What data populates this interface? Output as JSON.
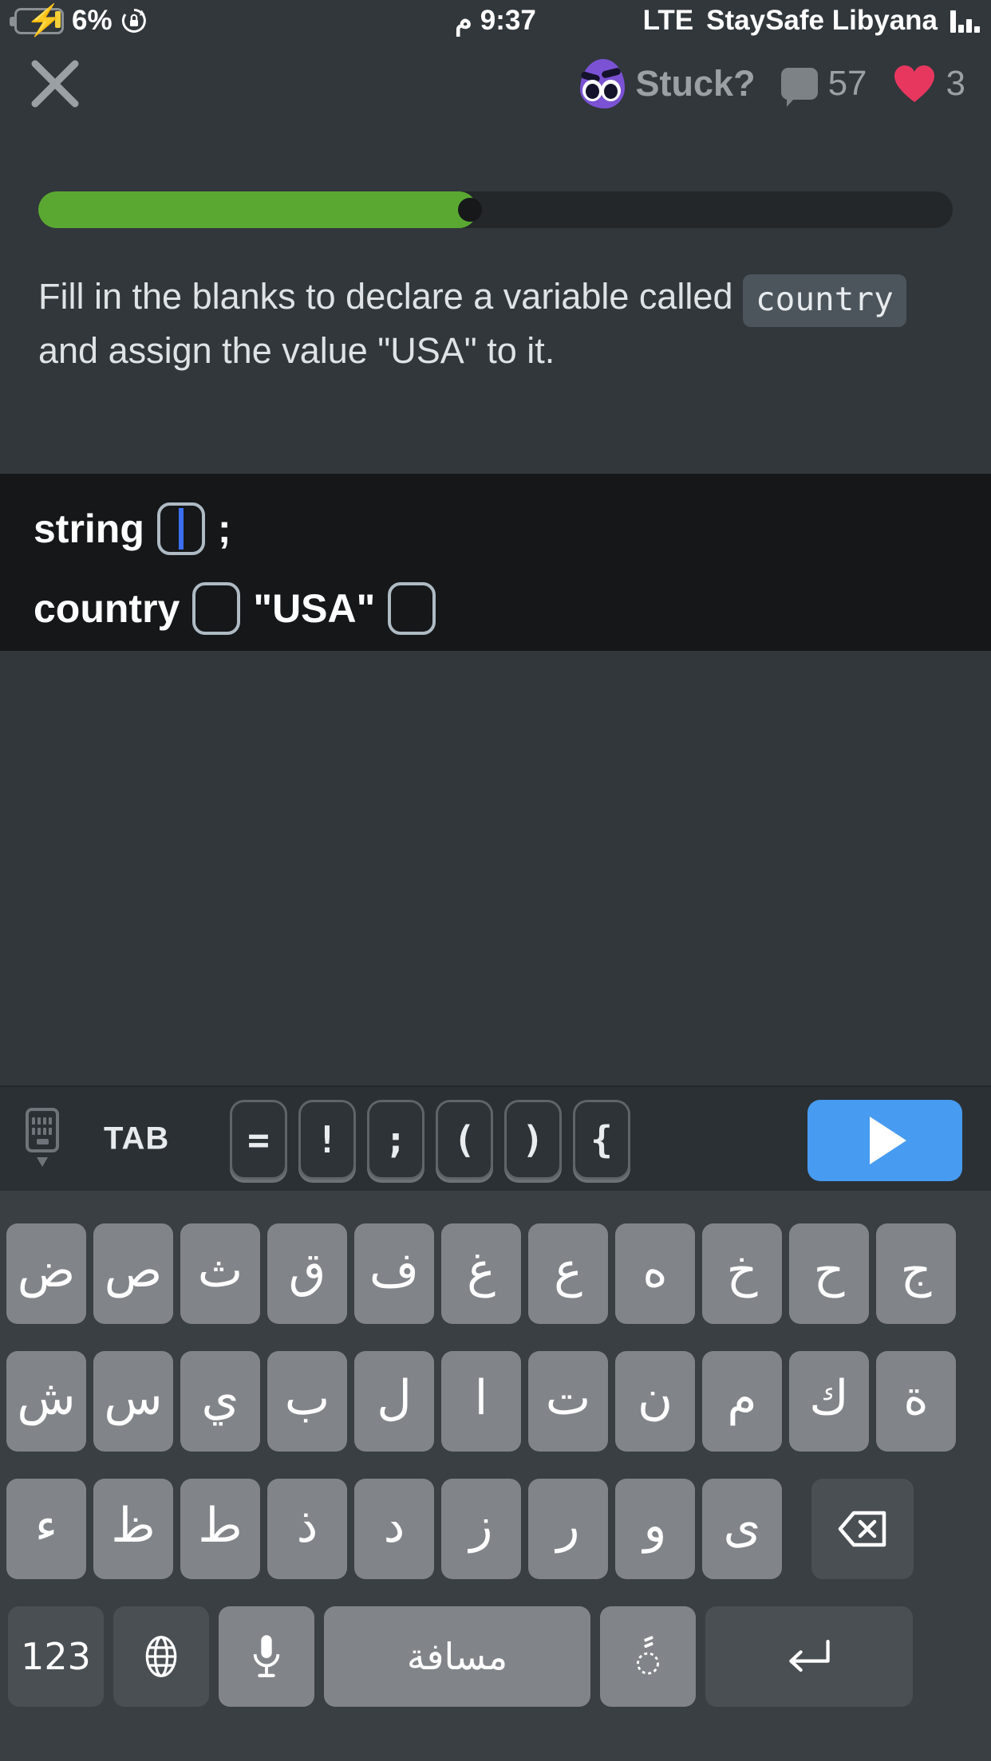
{
  "status_bar": {
    "battery_percent": "6%",
    "battery_icon": "battery-charging-icon",
    "rotation_lock_icon": "rotation-lock-icon",
    "time": "9:37",
    "time_suffix": "م",
    "network_type": "LTE",
    "carrier": "StaySafe Libyana",
    "signal_icon": "signal-bars-icon"
  },
  "header": {
    "close_icon": "close-icon",
    "mascot_icon": "mascot-avatar-icon",
    "stuck_label": "Stuck?",
    "comments_icon": "comment-bubble-icon",
    "comments_count": "57",
    "hearts_icon": "heart-icon",
    "hearts_count": "3"
  },
  "progress": {
    "percent": 48,
    "fill_color": "#5aa832",
    "track_color": "#23272a",
    "knob_color": "#16181a"
  },
  "question": {
    "text_before": "Fill in the blanks to declare a variable called ",
    "code_chip": "country",
    "text_after": "and assign the value \"USA\" to it."
  },
  "editor": {
    "background": "#151719",
    "line1": {
      "keyword": "string",
      "blank_1_value": "",
      "blank_1_has_caret": true,
      "terminator": ";"
    },
    "line2": {
      "identifier": "country",
      "blank_2_value": "",
      "literal": "\"USA\"",
      "blank_3_value": ""
    },
    "caret_color": "#3b6ef0",
    "blank_border_color": "#aebbc4"
  },
  "toolbar": {
    "dismiss_keyboard_icon": "keyboard-dismiss-icon",
    "tab_label": "TAB",
    "symbol_keys": [
      "=",
      "!",
      ";",
      "(",
      ")",
      "{"
    ],
    "run_icon": "play-triangle-icon",
    "run_button_color": "#479bf0"
  },
  "keyboard": {
    "language": "arabic",
    "row1": [
      "ض",
      "ص",
      "ث",
      "ق",
      "ف",
      "غ",
      "ع",
      "ه",
      "خ",
      "ح",
      "ج"
    ],
    "row2": [
      "ش",
      "س",
      "ي",
      "ب",
      "ل",
      "ا",
      "ت",
      "ن",
      "م",
      "ك",
      "ة"
    ],
    "row3": [
      "ء",
      "ظ",
      "ط",
      "ذ",
      "د",
      "ز",
      "ر",
      "و",
      "ى"
    ],
    "backspace_icon": "backspace-icon",
    "row4": {
      "numbers_label": "123",
      "globe_icon": "globe-icon",
      "mic_icon": "microphone-icon",
      "space_label": "مسافة",
      "diacritics_icon": "diacritics-icon",
      "return_icon": "return-arrow-icon"
    },
    "key_color": "#818589",
    "special_key_color": "#4a4f53"
  }
}
